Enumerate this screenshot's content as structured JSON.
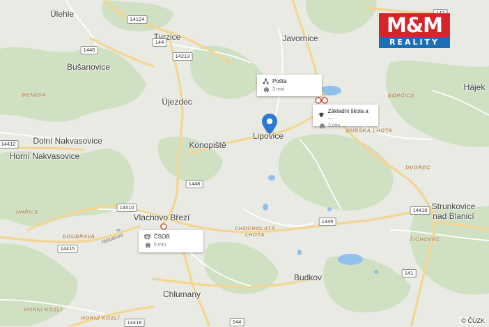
{
  "map": {
    "colors": {
      "background": "#e8eae3",
      "forest": "#cfe0c3",
      "water": "#8fc1ec",
      "road_major": "#f7d998",
      "road_minor": "#ffffff",
      "pin": "#2b78d5"
    },
    "places": {
      "ulehle": "Úlehle",
      "tvrzice": "Tvrzice",
      "javornice": "Javornice",
      "busanovice": "Bušanovice",
      "hajek": "Hájek",
      "ujezdec": "Újezdec",
      "dolni_nakvasovice": "Dolní Nakvasovice",
      "horni_nakvasovice": "Horní Nakvasovice",
      "konopiste": "Konopiště",
      "lipovice": "Lipovice",
      "vlachovo_brezi": "Vlachovo Březí",
      "strunkovice": "Strunkovice\nnad Blanicí",
      "budkov": "Budkov",
      "chlumany": "Chlumany"
    },
    "districts": {
      "borcice": "BORČICE",
      "beneda": "BENEDA",
      "dubska_lhota": "DUBSKÁ LHOTA",
      "dvorec": "DVOREC",
      "uhrice": "UHŘICE",
      "doubrava": "DOUBRAVA",
      "chocholata_lhota": "CHOCHOLATÁ\nLHOTA",
      "zichovec": "ŽICHOVEC",
      "horni_kozli_1": "HORNÍ KOZLÍ",
      "horni_kozli_2": "HORNÍ KOZLÍ"
    },
    "road_numbers": {
      "r14124": "14124",
      "r144a": "144",
      "r14213": "14213",
      "r1446": "1446",
      "r142": "142",
      "r14412": "14412",
      "r1448": "1448",
      "r14410": "14410",
      "r1449": "1449",
      "r14418a": "14418",
      "r14415": "14415",
      "r141": "141",
      "r14418b": "14418",
      "r144b": "144"
    },
    "road_name": "Netudova",
    "copyright": "© ČÚZK"
  },
  "pois": [
    {
      "name": "Pošta",
      "time": "3 min",
      "icon": "post-office-icon"
    },
    {
      "name": "Základní škola a ...",
      "time": "3 min",
      "icon": "school-icon"
    },
    {
      "name": "ČSOB",
      "time": "5 min",
      "icon": "bank-icon"
    }
  ],
  "logo": {
    "top": "M&M",
    "bottom": "REALITY"
  }
}
